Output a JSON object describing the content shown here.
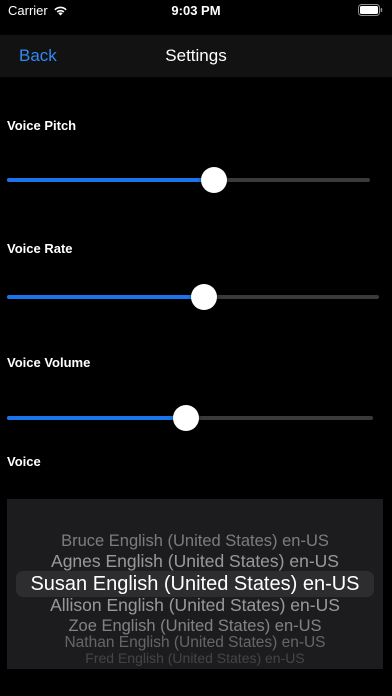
{
  "status_bar": {
    "carrier": "Carrier",
    "time": "9:03 PM",
    "wifi_icon": "wifi-icon",
    "battery_icon": "battery-icon"
  },
  "nav": {
    "back_label": "Back",
    "title": "Settings"
  },
  "settings": {
    "pitch": {
      "label": "Voice Pitch",
      "value": 0.57
    },
    "rate": {
      "label": "Voice Rate",
      "value": 0.53
    },
    "volume": {
      "label": "Voice Volume",
      "value": 0.49
    },
    "voice_label": "Voice"
  },
  "voice_picker": {
    "options": [
      "Bruce English (United States) en-US",
      "Agnes English (United States) en-US",
      "Susan English (United States) en-US",
      "Allison English (United States) en-US",
      "Zoe English (United States) en-US",
      "Nathan English (United States) en-US",
      "Fred English (United States) en-US"
    ],
    "selected_index": 2
  },
  "colors": {
    "accent": "#1a74ec",
    "link": "#2f8af5",
    "background": "#000000",
    "nav_background": "#121212",
    "picker_background": "#1c1c1e"
  }
}
